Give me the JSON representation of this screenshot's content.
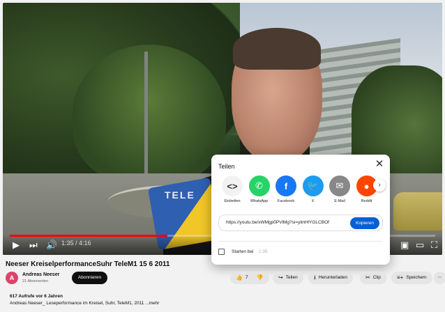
{
  "player": {
    "logo_text": "TELE",
    "time": "1:35 / 4:16",
    "progress_fraction": 0.37
  },
  "share": {
    "title": "Teilen",
    "targets": [
      {
        "label": "Einbetten",
        "icon": "embed-icon",
        "color": "#f2f2f2",
        "glyph": "<>"
      },
      {
        "label": "WhatsApp",
        "icon": "whatsapp-icon",
        "color": "#25d366",
        "glyph": "✆"
      },
      {
        "label": "Facebook",
        "icon": "facebook-icon",
        "color": "#1877f2",
        "glyph": "f"
      },
      {
        "label": "X",
        "icon": "x-bird-icon",
        "color": "#1d9bf0",
        "glyph": "🐦"
      },
      {
        "label": "E-Mail",
        "icon": "email-icon",
        "color": "#888888",
        "glyph": "✉"
      },
      {
        "label": "Reddit",
        "icon": "reddit-icon",
        "color": "#ff4500",
        "glyph": "●"
      }
    ],
    "url": "https://youtu.be/xWMgp0PVlMg?si=ylinHlYGLCBOf",
    "copy_label": "Kopieren",
    "start_label": "Starten bei",
    "start_time": "1:35"
  },
  "video": {
    "title": "Neeser KreiselperformanceSuhr TeleM1 15 6 2011",
    "channel_initial": "A",
    "channel": "Andreas Neeser",
    "subscribers": "21 Abonnenten",
    "subscribe_label": "Abonnieren",
    "likes": "7",
    "share_label": "Teilen",
    "download_label": "Herunterladen",
    "clip_label": "Clip",
    "save_label": "Speichern",
    "more_label": "⋯",
    "views": "617 Aufrufe  vor 6 Jahren",
    "description": "Andreas Neeser_ Leseperformance im Kreisel, Suhr, TeleM1, 2011 ...mehr"
  },
  "colors": {
    "accent": "#065fd4",
    "progress": "#ff0000",
    "subscribe_bg": "#0f0f0f"
  }
}
